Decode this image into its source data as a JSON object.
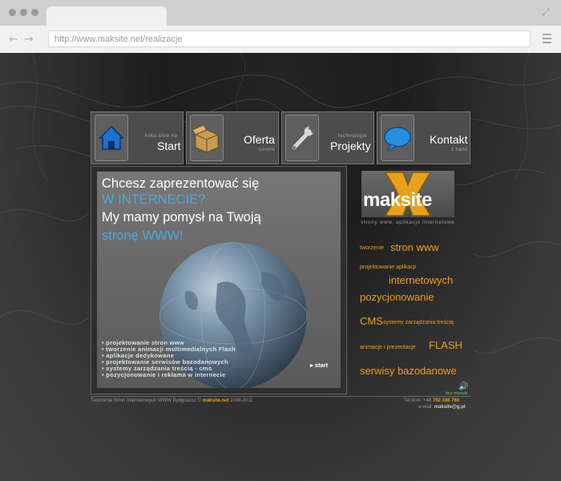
{
  "browser": {
    "url": "http://www.maksite.net/realizacje"
  },
  "nav": [
    {
      "small": "kilka słów na",
      "label": "Start",
      "icon": "house-icon"
    },
    {
      "small": "cennik",
      "label": "Oferta",
      "icon": "box-icon"
    },
    {
      "small": "technologie",
      "label": "Projekty",
      "icon": "wrench-icon"
    },
    {
      "small": "z nami",
      "label": "Kontakt",
      "icon": "speech-bubble-icon"
    }
  ],
  "hero": {
    "line1": "Chcesz zaprezentować się",
    "line2": "W INTERNECIE?",
    "line3": "My mamy pomysł na Twoją",
    "line4": "stronę WWW!",
    "items": [
      "• projektowanie stron www",
      "• tworzenie animacji multimedialnych Flash",
      "• aplikacje dedykowane",
      "• projektowanie serwisów bazodanowych",
      "• systemy zarządzania treścią - cms",
      "• pozycjonowanie i reklama w internecie"
    ],
    "start_link": "start"
  },
  "logo": {
    "text": "maksite",
    "subtitle": "strony www, aplikacje internetowe"
  },
  "tags": {
    "t1": "tworzenie",
    "t2": "stron www",
    "t3": "projektowanie aplikacji",
    "t4": "internetowych",
    "t5": "pozycjonowanie",
    "t6": "CMS",
    "t7": "systemy zarządzania treścią",
    "t8": "animacje i prezentacje",
    "t9": "FLASH",
    "t10": "serwisy bazodanowe"
  },
  "music": {
    "label": "bez muzyki",
    "icon": "speaker-icon"
  },
  "footer": {
    "left": "Tworzenie Stron Internetowych WWW Bydgoszcz ©",
    "site": "maksite.net",
    "years": "2008-2011",
    "phone_label": "Tel.kom: +48",
    "phone": "792 348 760",
    "email_label": "e-mail:",
    "email": "maksite@g.pl"
  },
  "colors": {
    "accent": "#e8a020",
    "blue": "#4aa8e0",
    "green": "#6fcf3a"
  }
}
